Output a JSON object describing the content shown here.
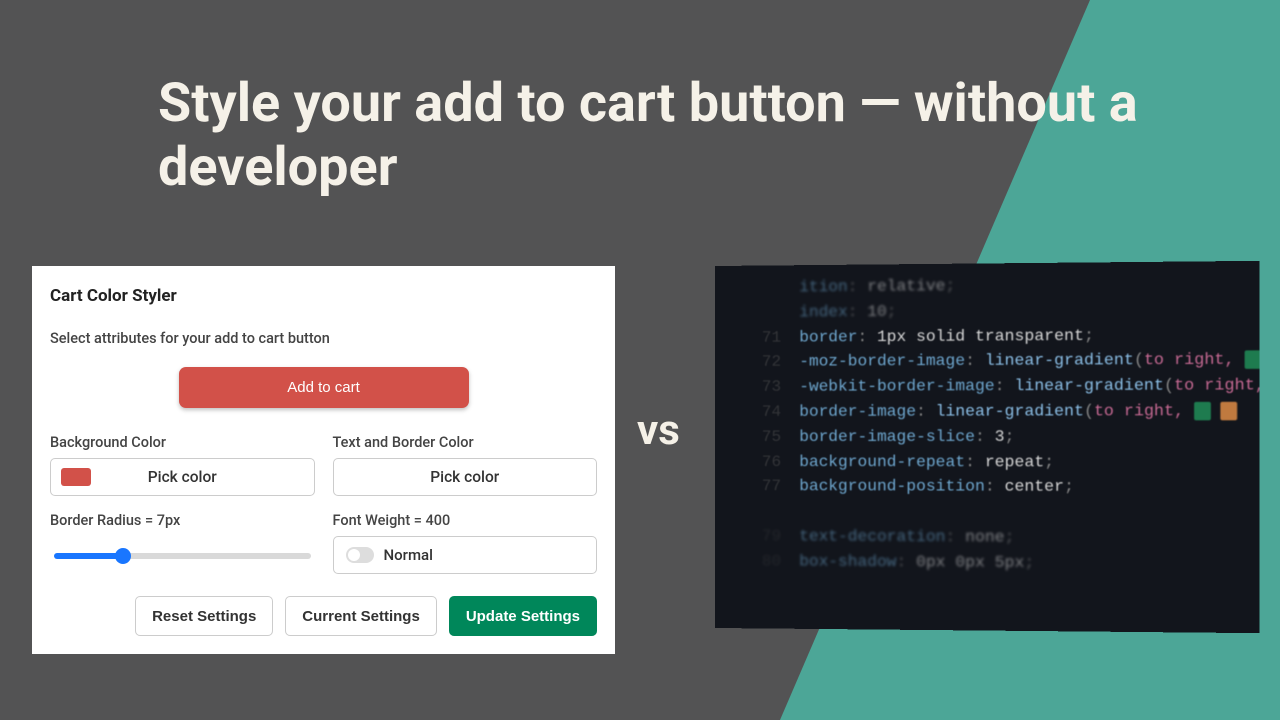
{
  "headline": "Style your add to cart button — without a developer",
  "vs": "vs",
  "styler": {
    "title": "Cart Color Styler",
    "subtitle": "Select attributes for your add to cart button",
    "preview_button": "Add to cart",
    "bg_label": "Background Color",
    "bg_pick": "Pick color",
    "bg_swatch": "#d25149",
    "text_label": "Text and Border Color",
    "text_pick": "Pick color",
    "radius_label": "Border Radius = 7px",
    "radius_value": 7,
    "weight_label": "Font Weight = 400",
    "weight_toggle": "Normal",
    "actions": {
      "reset": "Reset Settings",
      "current": "Current Settings",
      "update": "Update Settings"
    }
  },
  "code": [
    {
      "ln": "",
      "p": "ition",
      "v": "relative",
      "faded": true
    },
    {
      "ln": "",
      "p": "index",
      "v": "10",
      "faded": true
    },
    {
      "ln": "71",
      "p": "border",
      "v": "1px solid transparent",
      "faded": false
    },
    {
      "ln": "72",
      "p": "-moz-border-image",
      "func": "linear-gradient",
      "args": [
        "to right,",
        ""
      ],
      "faded": false
    },
    {
      "ln": "73",
      "p": "-webkit-border-image",
      "func": "linear-gradient",
      "args": [
        "to right,",
        ""
      ],
      "faded": false
    },
    {
      "ln": "74",
      "p": "border-image",
      "func": "linear-gradient",
      "args": [
        "to right,",
        ""
      ],
      "faded": false
    },
    {
      "ln": "75",
      "p": "border-image-slice",
      "v": "3",
      "faded": false
    },
    {
      "ln": "76",
      "p": "background-repeat",
      "v": "repeat",
      "faded": false
    },
    {
      "ln": "77",
      "p": "background-position",
      "v": "center",
      "faded": false
    },
    {
      "ln": "",
      "p": "",
      "v": "",
      "faded": true
    },
    {
      "ln": "79",
      "p": "text-decoration",
      "v": "none",
      "faded": true
    },
    {
      "ln": "80",
      "p": "box-shadow",
      "v": "0px 0px 5px",
      "faded": true
    }
  ]
}
